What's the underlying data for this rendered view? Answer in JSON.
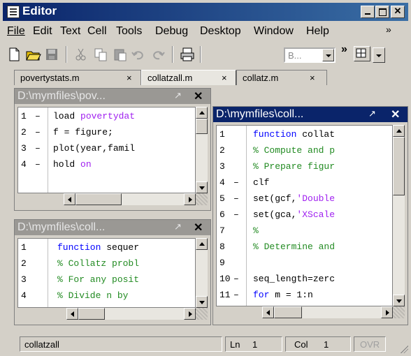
{
  "window": {
    "title": "Editor"
  },
  "menu": [
    "File",
    "Edit",
    "Text",
    "Cell",
    "Tools",
    "Debug",
    "Desktop",
    "Window",
    "Help"
  ],
  "toolbar": {
    "font_combo_value": "B..."
  },
  "tabs": [
    {
      "label": "povertystats.m",
      "close": "×"
    },
    {
      "label": "collatzall.m",
      "close": "×"
    },
    {
      "label": "collatz.m",
      "close": "×"
    }
  ],
  "panes": {
    "top_left": {
      "title": "D:\\mymfiles\\pov...",
      "lines": [
        {
          "n": "1",
          "dash": "–",
          "parts": [
            {
              "t": "load ",
              "c": ""
            },
            {
              "t": "povertydat",
              "c": "str"
            }
          ]
        },
        {
          "n": "2",
          "dash": "–",
          "parts": [
            {
              "t": "f = figure;",
              "c": ""
            }
          ]
        },
        {
          "n": "3",
          "dash": "–",
          "parts": [
            {
              "t": "plot(year,famil",
              "c": ""
            }
          ]
        },
        {
          "n": "4",
          "dash": "–",
          "parts": [
            {
              "t": "hold ",
              "c": ""
            },
            {
              "t": "on",
              "c": "str"
            }
          ]
        }
      ]
    },
    "bottom_left": {
      "title": "D:\\mymfiles\\coll...",
      "lines": [
        {
          "n": "1",
          "dash": "",
          "parts": [
            {
              "t": "function ",
              "c": "kw"
            },
            {
              "t": "sequer",
              "c": ""
            }
          ]
        },
        {
          "n": "2",
          "dash": "",
          "parts": [
            {
              "t": "% Collatz probl",
              "c": "cm"
            }
          ]
        },
        {
          "n": "3",
          "dash": "",
          "parts": [
            {
              "t": "% For any posit",
              "c": "cm"
            }
          ]
        },
        {
          "n": "4",
          "dash": "",
          "parts": [
            {
              "t": "%   Divide n by",
              "c": "cm"
            }
          ]
        }
      ]
    },
    "right": {
      "title": "D:\\mymfiles\\coll...",
      "lines": [
        {
          "n": "1",
          "dash": "",
          "parts": [
            {
              "t": "function ",
              "c": "kw"
            },
            {
              "t": "collat",
              "c": ""
            }
          ]
        },
        {
          "n": "2",
          "dash": "",
          "parts": [
            {
              "t": "% Compute and p",
              "c": "cm"
            }
          ]
        },
        {
          "n": "3",
          "dash": "",
          "parts": [
            {
              "t": "% Prepare figur",
              "c": "cm"
            }
          ]
        },
        {
          "n": "4",
          "dash": "–",
          "parts": [
            {
              "t": "clf",
              "c": ""
            }
          ]
        },
        {
          "n": "5",
          "dash": "–",
          "parts": [
            {
              "t": "set(gcf,",
              "c": ""
            },
            {
              "t": "'Double",
              "c": "str"
            }
          ]
        },
        {
          "n": "6",
          "dash": "–",
          "parts": [
            {
              "t": "set(gca,",
              "c": ""
            },
            {
              "t": "'XScale",
              "c": "str"
            }
          ]
        },
        {
          "n": "7",
          "dash": "",
          "parts": [
            {
              "t": "%",
              "c": "cm"
            }
          ]
        },
        {
          "n": "8",
          "dash": "",
          "parts": [
            {
              "t": "% Determine and",
              "c": "cm"
            }
          ]
        },
        {
          "n": "9",
          "dash": "",
          "parts": []
        },
        {
          "n": "10",
          "dash": "–",
          "parts": [
            {
              "t": "seq_length=zerc",
              "c": ""
            }
          ]
        },
        {
          "n": "11",
          "dash": "–",
          "parts": [
            {
              "t": "for ",
              "c": "kw"
            },
            {
              "t": "m = 1:n",
              "c": ""
            }
          ]
        }
      ]
    }
  },
  "status": {
    "file": "collatzall",
    "ln_label": "Ln",
    "ln_value": "1",
    "col_label": "Col",
    "col_value": "1",
    "ovr": "OVR"
  }
}
